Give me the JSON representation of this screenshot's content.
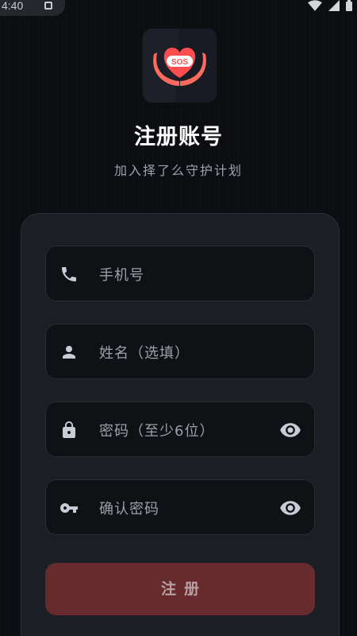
{
  "status_bar": {
    "time": "4:40"
  },
  "logo": {
    "text": "SOS",
    "icon": "sos-heart-hands-icon",
    "colors": {
      "heart": "#ff4d4f",
      "hands": "#ff6b5e",
      "bg": "#1d2029"
    }
  },
  "header": {
    "title": "注册账号",
    "subtitle": "加入择了么守护计划"
  },
  "form": {
    "phone": {
      "placeholder": "手机号",
      "icon": "phone-icon"
    },
    "name": {
      "placeholder": "姓名（选填）",
      "icon": "person-icon"
    },
    "password": {
      "placeholder": "密码（至少6位）",
      "icon": "lock-icon",
      "toggle_icon": "eye-icon"
    },
    "confirm_password": {
      "placeholder": "确认密码",
      "icon": "key-icon",
      "toggle_icon": "eye-icon"
    },
    "submit_label": "注册"
  },
  "colors": {
    "background": "#0c0d11",
    "card": "#1b1e24",
    "field": "#0f1115",
    "button": "#672a2d",
    "muted_text": "#9aa0aa"
  }
}
